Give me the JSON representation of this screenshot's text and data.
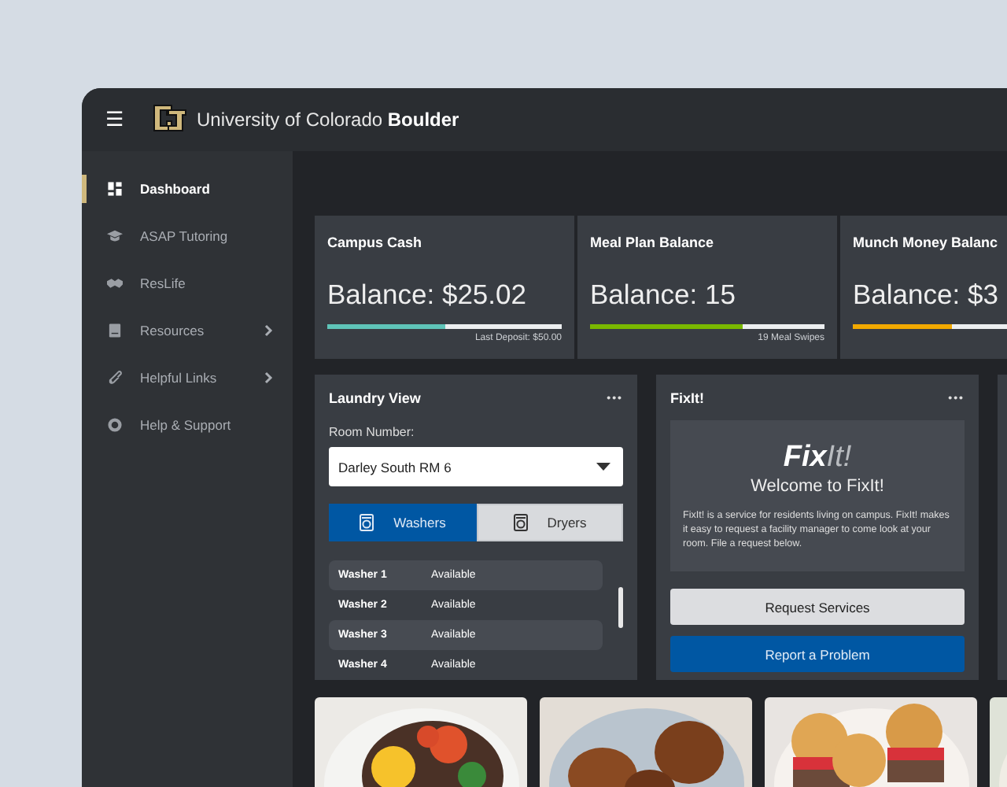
{
  "header": {
    "menu_icon": "☰",
    "university": "University of Colorado",
    "campus": "Boulder"
  },
  "sidebar": {
    "items": [
      {
        "label": "Dashboard",
        "selected": true,
        "submenu": false
      },
      {
        "label": "ASAP Tutoring",
        "selected": false,
        "submenu": false
      },
      {
        "label": "ResLife",
        "selected": false,
        "submenu": false
      },
      {
        "label": "Resources",
        "selected": false,
        "submenu": true
      },
      {
        "label": "Helpful Links",
        "selected": false,
        "submenu": true
      },
      {
        "label": "Help & Support",
        "selected": false,
        "submenu": false
      }
    ]
  },
  "balances": [
    {
      "title": "Campus Cash",
      "balance": "Balance: $25.02",
      "level": 0.5,
      "color": "#5fc4b8",
      "note": "Last Deposit: $50.00"
    },
    {
      "title": "Meal Plan Balance",
      "balance": "Balance: 15",
      "level": 0.65,
      "color": "#7ab800",
      "note": "19 Meal Swipes"
    },
    {
      "title": "Munch Money Balanc",
      "balance": "Balance: $3",
      "level": 0.42,
      "color": "#f2a900"
    }
  ],
  "laundry": {
    "title": "Laundry View",
    "menu": "•••",
    "room_label": "Room Number:",
    "room": "Darley South RM 6",
    "tabs": [
      {
        "label": "Washers",
        "selected": true
      },
      {
        "label": "Dryers",
        "selected": false
      }
    ],
    "machines": [
      {
        "name": "Washer 1",
        "status": "Available"
      },
      {
        "name": "Washer 2",
        "status": "Available"
      },
      {
        "name": "Washer 3",
        "status": "Available"
      },
      {
        "name": "Washer 4",
        "status": "Available"
      }
    ]
  },
  "fixit": {
    "title": "FixIt!",
    "menu": "•••",
    "logo_bold": "Fix",
    "logo_light": "It!",
    "welcome": "Welcome to FixIt!",
    "description": "FixIt! is a service for residents living on campus. FixIt! makes it easy to request a facility manager to come look at your room. File a request below.",
    "buttons": [
      {
        "label": "Request Services",
        "kind": "secondary"
      },
      {
        "label": "Report a Problem",
        "kind": "primary"
      }
    ]
  }
}
